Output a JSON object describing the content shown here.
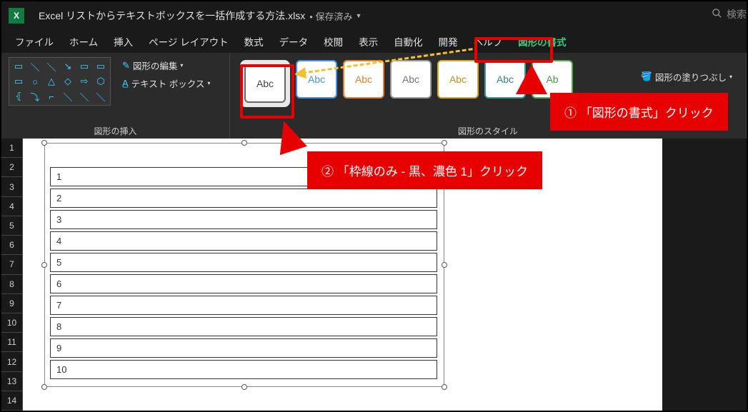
{
  "title": "Excel リストからテキストボックスを一括作成する方法.xlsx",
  "save_status": "• 保存済み",
  "search_placeholder": "検索",
  "tabs": {
    "file": "ファイル",
    "home": "ホーム",
    "insert": "挿入",
    "pagelayout": "ページ レイアウト",
    "formulas": "数式",
    "data": "データ",
    "review": "校閲",
    "view": "表示",
    "automate": "自動化",
    "developer": "開発",
    "help": "ヘルプ",
    "shapeformat": "図形の書式"
  },
  "shape_tools": {
    "edit_shape": "図形の編集",
    "text_box": "テキスト ボックス"
  },
  "groups": {
    "insert_shapes": "図形の挿入",
    "shape_styles": "図形のスタイル"
  },
  "swatches": {
    "s1": "Abc",
    "s2": "Abc",
    "s3": "Abc",
    "s4": "Abc",
    "s5": "Abc",
    "s6": "Abc",
    "s7": "Ab"
  },
  "fill_label": "図形の塗りつぶし",
  "callouts": {
    "c1": "① 「図形の書式」クリック",
    "c2": "② 「枠線のみ - 黒、濃色 1」クリック"
  },
  "rows": [
    "1",
    "2",
    "3",
    "4",
    "5",
    "6",
    "7",
    "8",
    "9",
    "10",
    "11",
    "12",
    "13",
    "14"
  ],
  "textboxes": [
    "1",
    "2",
    "3",
    "4",
    "5",
    "6",
    "7",
    "8",
    "9",
    "10"
  ],
  "colors": {
    "accent_red": "#e60000",
    "accent_green": "#41c77a"
  }
}
